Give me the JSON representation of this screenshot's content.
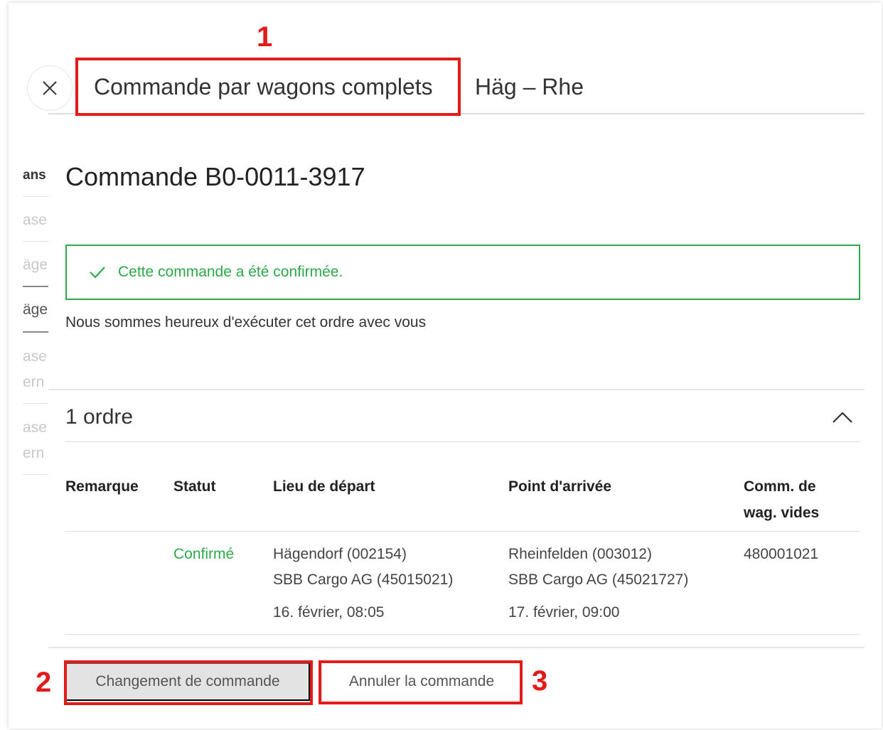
{
  "background": {
    "items": [
      "ans",
      "ase",
      "äge",
      "äge",
      "ase",
      "ern",
      "ase",
      "ern"
    ]
  },
  "header": {
    "title": "Commande par wagons complets",
    "route": "Häg – Rhe"
  },
  "order": {
    "title": "Commande B0-0011-3917",
    "confirmation": "Cette commande a été confirmée.",
    "message": "Nous sommes heureux d'exécuter cet ordre avec vous"
  },
  "orders_section": {
    "title": "1 ordre",
    "columns": [
      "Remarque",
      "Statut",
      "Lieu de départ",
      "Point d'arrivée",
      "Comm. de wag. vides"
    ],
    "rows": [
      {
        "remark": "",
        "status": "Confirmé",
        "departure_place": "Hägendorf (002154)",
        "departure_company": "SBB Cargo AG (45015021)",
        "departure_time": "16. février, 08:05",
        "arrival_place": "Rheinfelden (003012)",
        "arrival_company": "SBB Cargo AG (45021727)",
        "arrival_time": "17. février, 09:00",
        "empty_wagon_order": "480001021"
      }
    ]
  },
  "buttons": {
    "change": "Changement de commande",
    "cancel": "Annuler la commande"
  },
  "annotations": [
    "1",
    "2",
    "3"
  ],
  "colors": {
    "success": "#2ea84a",
    "annotation": "#e11a1a",
    "fab": "#1e6ee6"
  }
}
